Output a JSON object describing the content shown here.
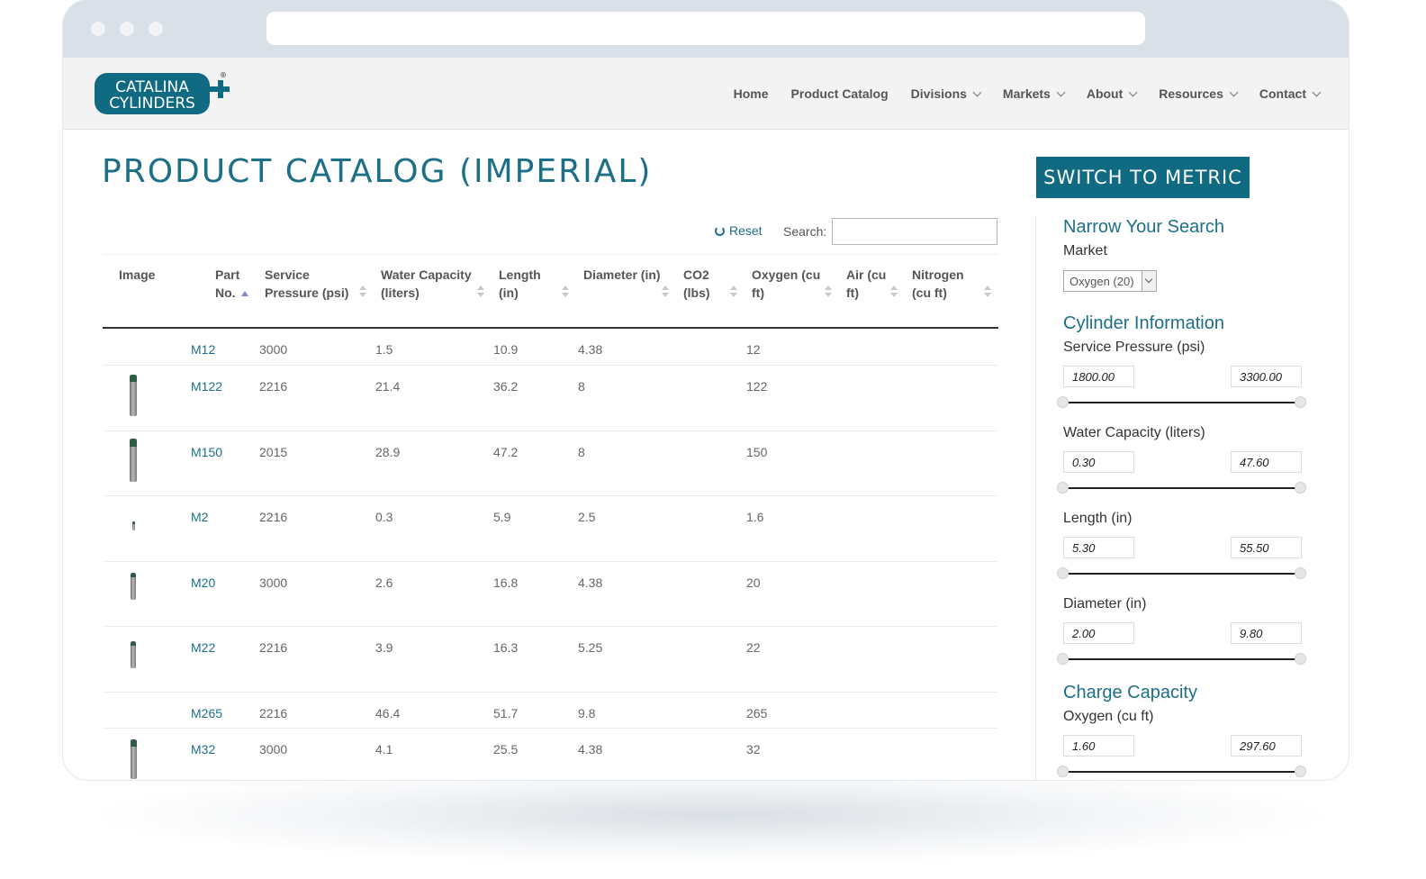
{
  "logo": {
    "line1": "CATALINA",
    "line2": "CYLINDERS",
    "mark": "®"
  },
  "nav": {
    "items": [
      {
        "label": "Home",
        "dropdown": false
      },
      {
        "label": "Product Catalog",
        "dropdown": false
      },
      {
        "label": "Divisions",
        "dropdown": true
      },
      {
        "label": "Markets",
        "dropdown": true
      },
      {
        "label": "About",
        "dropdown": true
      },
      {
        "label": "Resources",
        "dropdown": true
      },
      {
        "label": "Contact",
        "dropdown": true
      }
    ]
  },
  "page": {
    "title": "PRODUCT CATALOG (IMPERIAL)",
    "switch_label": "SWITCH TO METRIC"
  },
  "toolbar": {
    "reset_label": "Reset",
    "search_label": "Search:",
    "search_value": ""
  },
  "table": {
    "columns": [
      {
        "key": "image",
        "label": "Image"
      },
      {
        "key": "part",
        "label": "Part No."
      },
      {
        "key": "pressure",
        "label": "Service Pressure (psi)"
      },
      {
        "key": "water",
        "label": "Water Capacity (liters)"
      },
      {
        "key": "length",
        "label": "Length (in)"
      },
      {
        "key": "diameter",
        "label": "Diameter (in)"
      },
      {
        "key": "co2",
        "label": "CO2 (lbs)"
      },
      {
        "key": "oxygen",
        "label": "Oxygen (cu ft)"
      },
      {
        "key": "air",
        "label": "Air (cu ft)"
      },
      {
        "key": "nitrogen",
        "label": "Nitrogen (cu ft)"
      }
    ],
    "rows": [
      {
        "part": "M12",
        "pressure": "3000",
        "water": "1.5",
        "length": "10.9",
        "diameter": "4.38",
        "co2": "",
        "oxygen": "12",
        "air": "",
        "nitrogen": "",
        "has_image": false
      },
      {
        "part": "M122",
        "pressure": "2216",
        "water": "21.4",
        "length": "36.2",
        "diameter": "8",
        "co2": "",
        "oxygen": "122",
        "air": "",
        "nitrogen": "",
        "has_image": true
      },
      {
        "part": "M150",
        "pressure": "2015",
        "water": "28.9",
        "length": "47.2",
        "diameter": "8",
        "co2": "",
        "oxygen": "150",
        "air": "",
        "nitrogen": "",
        "has_image": true
      },
      {
        "part": "M2",
        "pressure": "2216",
        "water": "0.3",
        "length": "5.9",
        "diameter": "2.5",
        "co2": "",
        "oxygen": "1.6",
        "air": "",
        "nitrogen": "",
        "has_image": true
      },
      {
        "part": "M20",
        "pressure": "3000",
        "water": "2.6",
        "length": "16.8",
        "diameter": "4.38",
        "co2": "",
        "oxygen": "20",
        "air": "",
        "nitrogen": "",
        "has_image": true
      },
      {
        "part": "M22",
        "pressure": "2216",
        "water": "3.9",
        "length": "16.3",
        "diameter": "5.25",
        "co2": "",
        "oxygen": "22",
        "air": "",
        "nitrogen": "",
        "has_image": true
      },
      {
        "part": "M265",
        "pressure": "2216",
        "water": "46.4",
        "length": "51.7",
        "diameter": "9.8",
        "co2": "",
        "oxygen": "265",
        "air": "",
        "nitrogen": "",
        "has_image": false
      },
      {
        "part": "M32",
        "pressure": "3000",
        "water": "4.1",
        "length": "25.5",
        "diameter": "4.38",
        "co2": "",
        "oxygen": "32",
        "air": "",
        "nitrogen": "",
        "has_image": true
      }
    ]
  },
  "sidebar": {
    "narrow_heading": "Narrow Your Search",
    "market_label": "Market",
    "market_selected": "Oxygen (20)",
    "cyl_heading": "Cylinder Information",
    "charge_heading": "Charge Capacity",
    "ranges": {
      "pressure": {
        "label": "Service Pressure (psi)",
        "min": "1800.00",
        "max": "3300.00"
      },
      "water": {
        "label": "Water Capacity (liters)",
        "min": "0.30",
        "max": "47.60"
      },
      "length": {
        "label": "Length (in)",
        "min": "5.30",
        "max": "55.50"
      },
      "diameter": {
        "label": "Diameter (in)",
        "min": "2.00",
        "max": "9.80"
      },
      "oxygen": {
        "label": "Oxygen (cu ft)",
        "min": "1.60",
        "max": "297.60"
      }
    }
  },
  "colors": {
    "brand": "#1d6f88",
    "button_bg": "#0f6a82",
    "chrome": "#d9e0e8",
    "header_bg": "#f3f3f3"
  }
}
